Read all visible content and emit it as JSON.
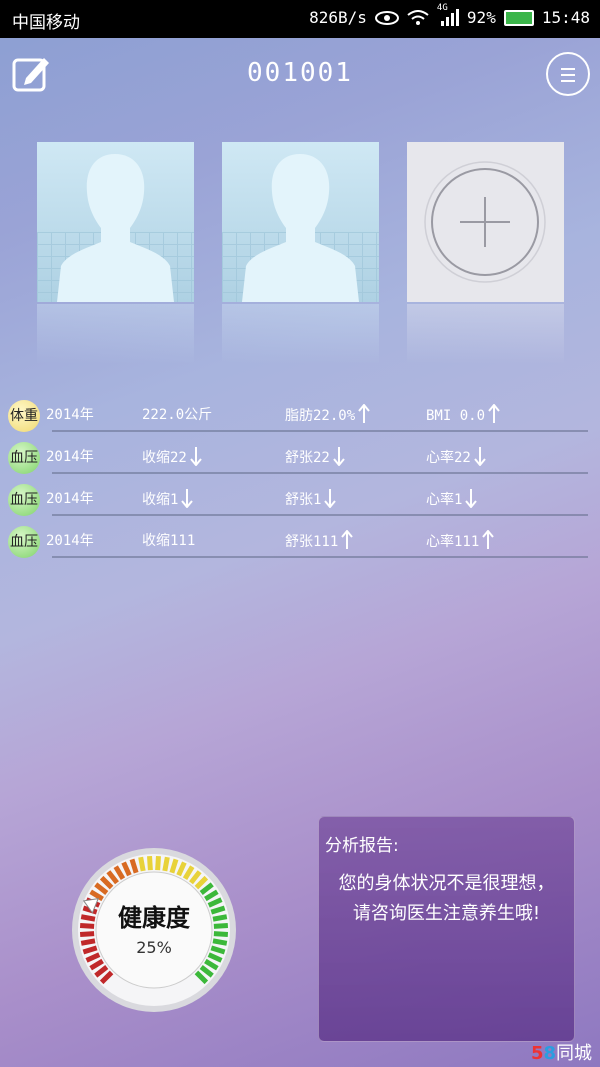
{
  "status_bar": {
    "carrier": "中国移动",
    "speed": "826B/s",
    "network": "4G",
    "battery": "92%",
    "time": "15:48"
  },
  "header": {
    "title": "001001"
  },
  "profiles": [
    {
      "type": "user"
    },
    {
      "type": "user"
    },
    {
      "type": "add"
    }
  ],
  "records": [
    {
      "tag": "体重",
      "tag_kind": "weight",
      "year": "2014年",
      "c1": "222.0公斤",
      "c1_arrow": "",
      "c2": "脂肪22.0%",
      "c2_arrow": "up",
      "c3": "BMI 0.0",
      "c3_arrow": "up"
    },
    {
      "tag": "血压",
      "tag_kind": "bp",
      "year": "2014年",
      "c1": "收缩22",
      "c1_arrow": "down",
      "c2": "舒张22",
      "c2_arrow": "down",
      "c3": "心率22",
      "c3_arrow": "down"
    },
    {
      "tag": "血压",
      "tag_kind": "bp",
      "year": "2014年",
      "c1": "收缩1",
      "c1_arrow": "down",
      "c2": "舒张1",
      "c2_arrow": "down",
      "c3": "心率1",
      "c3_arrow": "down"
    },
    {
      "tag": "血压",
      "tag_kind": "bp",
      "year": "2014年",
      "c1": "收缩111",
      "c1_arrow": "",
      "c2": "舒张111",
      "c2_arrow": "up",
      "c3": "心率111",
      "c3_arrow": "up"
    }
  ],
  "health_gauge": {
    "label": "健康度",
    "value_text": "25%",
    "value": 0.25
  },
  "report": {
    "title": "分析报告:",
    "body": "您的身体状况不是很理想，请咨询医生注意养生哦!"
  },
  "watermark": {
    "five": "5",
    "eight": "8",
    "text": "同城"
  }
}
